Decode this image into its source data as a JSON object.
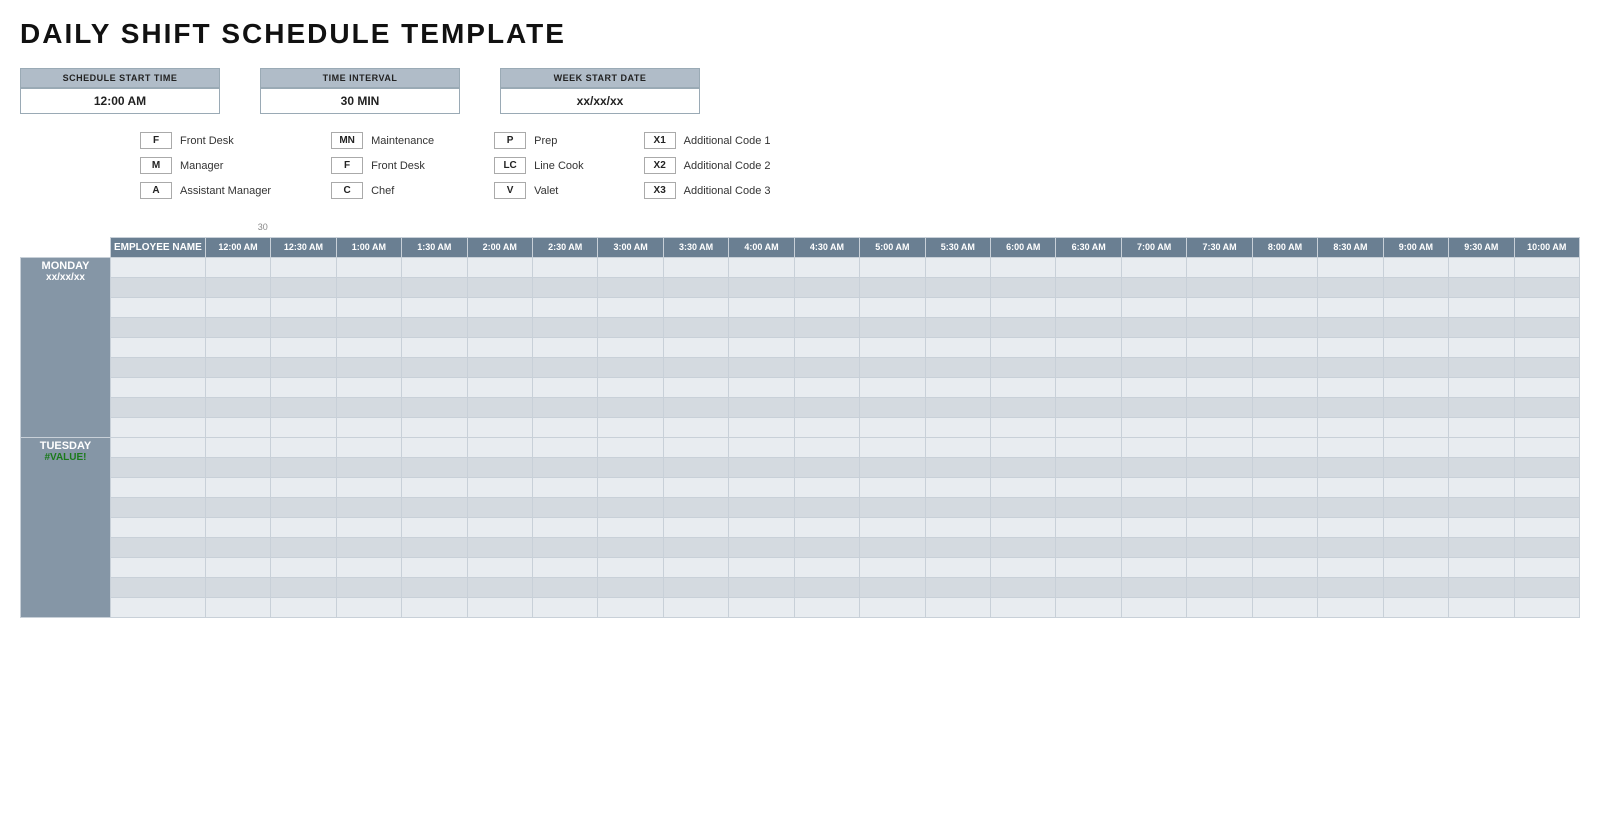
{
  "page": {
    "title": "DAILY SHIFT SCHEDULE TEMPLATE"
  },
  "config": {
    "blocks": [
      {
        "label": "SCHEDULE START TIME",
        "value": "12:00 AM"
      },
      {
        "label": "TIME INTERVAL",
        "value": "30 MIN"
      },
      {
        "label": "WEEK START DATE",
        "value": "xx/xx/xx"
      }
    ]
  },
  "legend": {
    "columns": [
      [
        {
          "code": "F",
          "desc": "Front Desk"
        },
        {
          "code": "M",
          "desc": "Manager"
        },
        {
          "code": "A",
          "desc": "Assistant Manager"
        }
      ],
      [
        {
          "code": "MN",
          "desc": "Maintenance"
        },
        {
          "code": "F",
          "desc": "Front Desk"
        },
        {
          "code": "C",
          "desc": "Chef"
        }
      ],
      [
        {
          "code": "P",
          "desc": "Prep"
        },
        {
          "code": "LC",
          "desc": "Line Cook"
        },
        {
          "code": "V",
          "desc": "Valet"
        }
      ],
      [
        {
          "code": "X1",
          "desc": "Additional Code 1"
        },
        {
          "code": "X2",
          "desc": "Additional Code 2"
        },
        {
          "code": "X3",
          "desc": "Additional Code 3"
        }
      ]
    ]
  },
  "schedule": {
    "employee_header": "EMPLOYEE NAME",
    "time_slots": [
      "12:00 AM",
      "12:30 AM",
      "1:00 AM",
      "1:30 AM",
      "2:00 AM",
      "2:30 AM",
      "3:00 AM",
      "3:30 AM",
      "4:00 AM",
      "4:30 AM",
      "5:00 AM",
      "5:30 AM",
      "6:00 AM",
      "6:30 AM",
      "7:00 AM",
      "7:30 AM",
      "8:00 AM",
      "8:30 AM",
      "9:00 AM",
      "9:30 AM",
      "10:00 AM"
    ],
    "num_label": "30",
    "days": [
      {
        "name": "MONDAY",
        "date": "xx/xx/xx",
        "rows": 9
      },
      {
        "name": "TUESDAY",
        "date": "#VALUE!",
        "date_class": "value-error",
        "rows": 9
      }
    ]
  }
}
